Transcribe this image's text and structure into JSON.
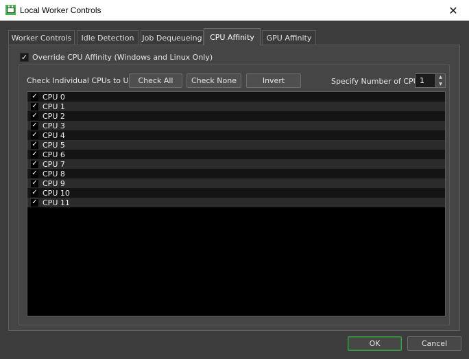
{
  "window": {
    "title": "Local Worker Controls",
    "close_glyph": "✕"
  },
  "tabs": [
    {
      "label": "Worker Controls",
      "active": false
    },
    {
      "label": "Idle Detection",
      "active": false
    },
    {
      "label": "Job Dequeueing",
      "active": false
    },
    {
      "label": "CPU Affinity",
      "active": true
    },
    {
      "label": "GPU Affinity",
      "active": false
    }
  ],
  "cpu_affinity": {
    "override": {
      "label": "Override CPU Affinity (Windows and Linux Only)",
      "checked": true
    },
    "check_individual_label": "Check Individual CPUs to Use",
    "buttons": {
      "check_all": "Check All",
      "check_none": "Check None",
      "invert": "Invert"
    },
    "specify_label": "Specify Number of CPUs",
    "specify_value": "1",
    "cpus": [
      {
        "label": "CPU 0",
        "checked": true
      },
      {
        "label": "CPU 1",
        "checked": true
      },
      {
        "label": "CPU 2",
        "checked": true
      },
      {
        "label": "CPU 3",
        "checked": true
      },
      {
        "label": "CPU 4",
        "checked": true
      },
      {
        "label": "CPU 5",
        "checked": true
      },
      {
        "label": "CPU 6",
        "checked": true
      },
      {
        "label": "CPU 7",
        "checked": true
      },
      {
        "label": "CPU 8",
        "checked": true
      },
      {
        "label": "CPU 9",
        "checked": true
      },
      {
        "label": "CPU 10",
        "checked": true
      },
      {
        "label": "CPU 11",
        "checked": true
      }
    ]
  },
  "footer": {
    "ok": "OK",
    "cancel": "Cancel"
  },
  "colors": {
    "accent_ok_border": "#3aa04a",
    "app_icon": "#4caf50"
  }
}
